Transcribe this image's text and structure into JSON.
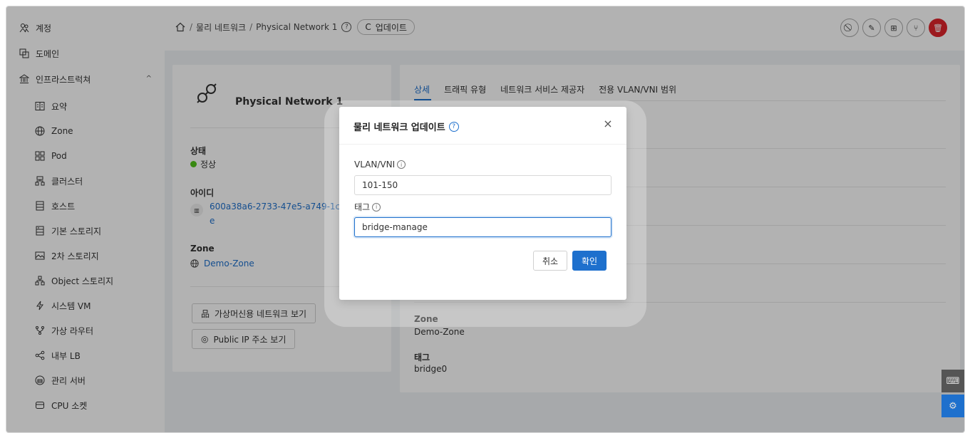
{
  "sidebar": {
    "items": [
      {
        "label": "계정",
        "icon": "account-icon"
      },
      {
        "label": "도메인",
        "icon": "domain-icon"
      },
      {
        "label": "인프라스트럭쳐",
        "icon": "bank-icon"
      },
      {
        "label": "요약",
        "icon": "summary-icon"
      },
      {
        "label": "Zone",
        "icon": "globe-icon"
      },
      {
        "label": "Pod",
        "icon": "pod-icon"
      },
      {
        "label": "클러스터",
        "icon": "cluster-icon"
      },
      {
        "label": "호스트",
        "icon": "host-icon"
      },
      {
        "label": "기본 스토리지",
        "icon": "primary-storage-icon"
      },
      {
        "label": "2차 스토리지",
        "icon": "secondary-storage-icon"
      },
      {
        "label": "Object 스토리지",
        "icon": "object-storage-icon"
      },
      {
        "label": "시스템 VM",
        "icon": "thunderbolt-icon"
      },
      {
        "label": "가상 라우터",
        "icon": "router-icon"
      },
      {
        "label": "내부 LB",
        "icon": "share-icon"
      },
      {
        "label": "관리 서버",
        "icon": "management-server-icon"
      },
      {
        "label": "CPU 소켓",
        "icon": "cpu-socket-icon"
      }
    ]
  },
  "header": {
    "breadcrumb": [
      "물리 네트워크",
      "Physical Network 1"
    ],
    "update_label": "업데이트"
  },
  "details": {
    "name": "Physical Network 1",
    "state_label": "상태",
    "state_value": "정상",
    "id_label": "아이디",
    "id_value_line1": "600a38a6-2733-47e5-a749-1c11",
    "id_value_line2": "e",
    "zone_label": "Zone",
    "zone_value": "Demo-Zone",
    "btn_guest_networks": "가상머신용 네트워크 보기",
    "btn_public_ip": "Public IP 주소 보기"
  },
  "tabs": [
    "상세",
    "트래픽 유형",
    "네트워크 서비스 제공자",
    "전용 VLAN/VNI 범위"
  ],
  "right_detail": {
    "zone_label": "Zone",
    "zone_value": "Demo-Zone",
    "tags_label": "태그",
    "tags_value": "bridge0"
  },
  "modal": {
    "title": "물리 네트워크 업데이트",
    "vlan_label": "VLAN/VNI",
    "vlan_value": "101-150",
    "tags_label": "태그",
    "tags_value": "bridge-manage",
    "cancel_label": "취소",
    "ok_label": "확인"
  },
  "colors": {
    "primary": "#1e70cd",
    "danger": "#e0242b",
    "success": "#52c41a"
  }
}
